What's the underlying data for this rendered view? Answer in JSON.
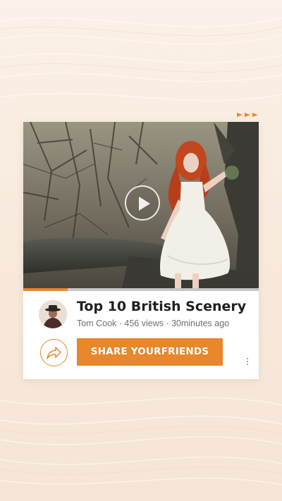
{
  "video": {
    "title": "Top 10 British Scenery",
    "author": "Tom Cook",
    "views": "456 views",
    "age": "30minutes ago",
    "progress_fraction": 0.19
  },
  "meta_separator": " · ",
  "actions": {
    "share_label": "SHARE YOURFRIENDS"
  },
  "icons": {
    "play": "play-icon",
    "share": "share-arrow-icon",
    "more": "more-vertical-icon",
    "arrows": "triple-arrow-icon"
  },
  "colors": {
    "accent": "#e8872c",
    "background": "#f8eadd",
    "title_text": "#1f1f1f",
    "meta_text": "#707070"
  }
}
